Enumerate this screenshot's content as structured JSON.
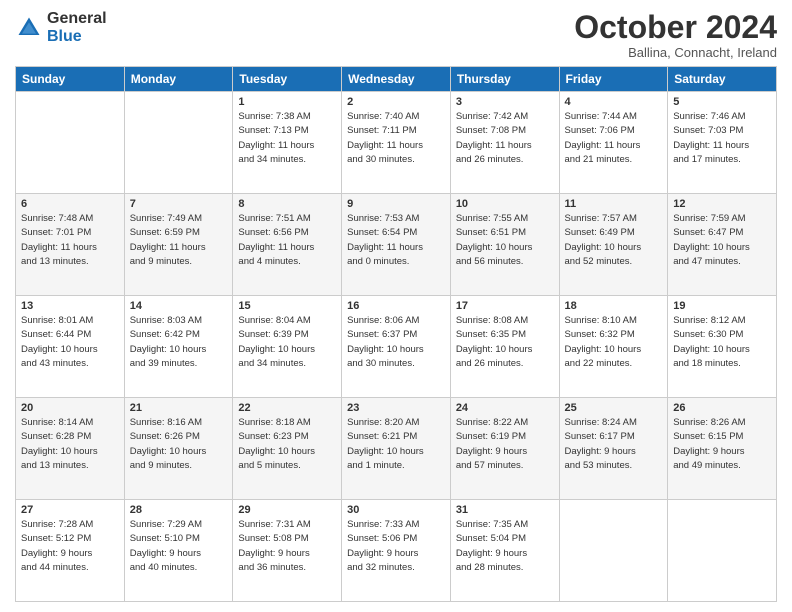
{
  "logo": {
    "line1": "General",
    "line2": "Blue"
  },
  "title": "October 2024",
  "subtitle": "Ballina, Connacht, Ireland",
  "days_header": [
    "Sunday",
    "Monday",
    "Tuesday",
    "Wednesday",
    "Thursday",
    "Friday",
    "Saturday"
  ],
  "weeks": [
    [
      {
        "day": "",
        "info": ""
      },
      {
        "day": "",
        "info": ""
      },
      {
        "day": "1",
        "info": "Sunrise: 7:38 AM\nSunset: 7:13 PM\nDaylight: 11 hours\nand 34 minutes."
      },
      {
        "day": "2",
        "info": "Sunrise: 7:40 AM\nSunset: 7:11 PM\nDaylight: 11 hours\nand 30 minutes."
      },
      {
        "day": "3",
        "info": "Sunrise: 7:42 AM\nSunset: 7:08 PM\nDaylight: 11 hours\nand 26 minutes."
      },
      {
        "day": "4",
        "info": "Sunrise: 7:44 AM\nSunset: 7:06 PM\nDaylight: 11 hours\nand 21 minutes."
      },
      {
        "day": "5",
        "info": "Sunrise: 7:46 AM\nSunset: 7:03 PM\nDaylight: 11 hours\nand 17 minutes."
      }
    ],
    [
      {
        "day": "6",
        "info": "Sunrise: 7:48 AM\nSunset: 7:01 PM\nDaylight: 11 hours\nand 13 minutes."
      },
      {
        "day": "7",
        "info": "Sunrise: 7:49 AM\nSunset: 6:59 PM\nDaylight: 11 hours\nand 9 minutes."
      },
      {
        "day": "8",
        "info": "Sunrise: 7:51 AM\nSunset: 6:56 PM\nDaylight: 11 hours\nand 4 minutes."
      },
      {
        "day": "9",
        "info": "Sunrise: 7:53 AM\nSunset: 6:54 PM\nDaylight: 11 hours\nand 0 minutes."
      },
      {
        "day": "10",
        "info": "Sunrise: 7:55 AM\nSunset: 6:51 PM\nDaylight: 10 hours\nand 56 minutes."
      },
      {
        "day": "11",
        "info": "Sunrise: 7:57 AM\nSunset: 6:49 PM\nDaylight: 10 hours\nand 52 minutes."
      },
      {
        "day": "12",
        "info": "Sunrise: 7:59 AM\nSunset: 6:47 PM\nDaylight: 10 hours\nand 47 minutes."
      }
    ],
    [
      {
        "day": "13",
        "info": "Sunrise: 8:01 AM\nSunset: 6:44 PM\nDaylight: 10 hours\nand 43 minutes."
      },
      {
        "day": "14",
        "info": "Sunrise: 8:03 AM\nSunset: 6:42 PM\nDaylight: 10 hours\nand 39 minutes."
      },
      {
        "day": "15",
        "info": "Sunrise: 8:04 AM\nSunset: 6:39 PM\nDaylight: 10 hours\nand 34 minutes."
      },
      {
        "day": "16",
        "info": "Sunrise: 8:06 AM\nSunset: 6:37 PM\nDaylight: 10 hours\nand 30 minutes."
      },
      {
        "day": "17",
        "info": "Sunrise: 8:08 AM\nSunset: 6:35 PM\nDaylight: 10 hours\nand 26 minutes."
      },
      {
        "day": "18",
        "info": "Sunrise: 8:10 AM\nSunset: 6:32 PM\nDaylight: 10 hours\nand 22 minutes."
      },
      {
        "day": "19",
        "info": "Sunrise: 8:12 AM\nSunset: 6:30 PM\nDaylight: 10 hours\nand 18 minutes."
      }
    ],
    [
      {
        "day": "20",
        "info": "Sunrise: 8:14 AM\nSunset: 6:28 PM\nDaylight: 10 hours\nand 13 minutes."
      },
      {
        "day": "21",
        "info": "Sunrise: 8:16 AM\nSunset: 6:26 PM\nDaylight: 10 hours\nand 9 minutes."
      },
      {
        "day": "22",
        "info": "Sunrise: 8:18 AM\nSunset: 6:23 PM\nDaylight: 10 hours\nand 5 minutes."
      },
      {
        "day": "23",
        "info": "Sunrise: 8:20 AM\nSunset: 6:21 PM\nDaylight: 10 hours\nand 1 minute."
      },
      {
        "day": "24",
        "info": "Sunrise: 8:22 AM\nSunset: 6:19 PM\nDaylight: 9 hours\nand 57 minutes."
      },
      {
        "day": "25",
        "info": "Sunrise: 8:24 AM\nSunset: 6:17 PM\nDaylight: 9 hours\nand 53 minutes."
      },
      {
        "day": "26",
        "info": "Sunrise: 8:26 AM\nSunset: 6:15 PM\nDaylight: 9 hours\nand 49 minutes."
      }
    ],
    [
      {
        "day": "27",
        "info": "Sunrise: 7:28 AM\nSunset: 5:12 PM\nDaylight: 9 hours\nand 44 minutes."
      },
      {
        "day": "28",
        "info": "Sunrise: 7:29 AM\nSunset: 5:10 PM\nDaylight: 9 hours\nand 40 minutes."
      },
      {
        "day": "29",
        "info": "Sunrise: 7:31 AM\nSunset: 5:08 PM\nDaylight: 9 hours\nand 36 minutes."
      },
      {
        "day": "30",
        "info": "Sunrise: 7:33 AM\nSunset: 5:06 PM\nDaylight: 9 hours\nand 32 minutes."
      },
      {
        "day": "31",
        "info": "Sunrise: 7:35 AM\nSunset: 5:04 PM\nDaylight: 9 hours\nand 28 minutes."
      },
      {
        "day": "",
        "info": ""
      },
      {
        "day": "",
        "info": ""
      }
    ]
  ]
}
